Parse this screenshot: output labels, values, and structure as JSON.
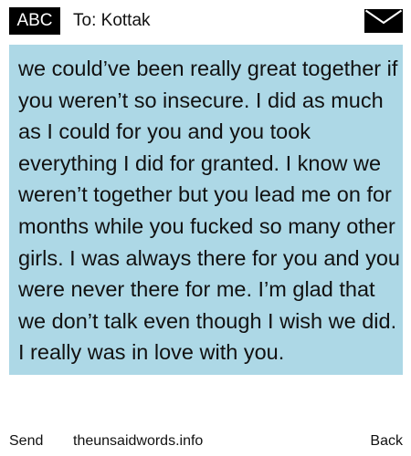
{
  "header": {
    "badge_label": "ABC",
    "to_label": "To:",
    "recipient": "Kottak",
    "envelope_icon": "envelope-icon"
  },
  "message": {
    "body": "we could’ve been really great together if you weren’t so insecure. I did as much as I could for you and you took everything I did for granted. I know we weren’t together but you lead me on for months while you fucked so many other girls. I was always there for you and you were never there for me. I’m glad that we don’t talk even though I wish we did. I really was in love with you."
  },
  "footer": {
    "send_label": "Send",
    "site_label": "theunsaidwords.info",
    "back_label": "Back"
  },
  "colors": {
    "message_background": "#add8e6",
    "badge_background": "#000000",
    "text": "#111111"
  }
}
